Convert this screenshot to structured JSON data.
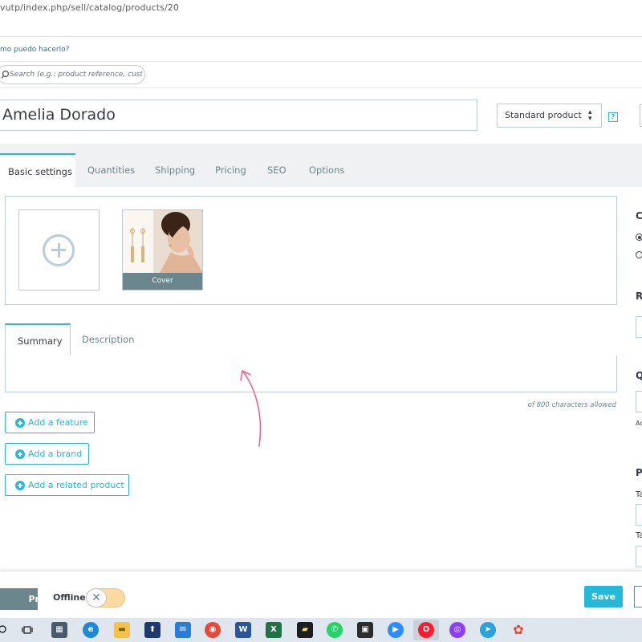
{
  "browser": {
    "url": "vutp/index.php/sell/catalog/products/20"
  },
  "header": {
    "help_link": "mo puedo hacerlo?",
    "search_placeholder": "Search (e.g.: product reference, custome"
  },
  "product": {
    "name": "Amelia Dorado",
    "type": "Standard product",
    "help_icon": "?"
  },
  "tabs": [
    {
      "label": "Basic settings",
      "active": true
    },
    {
      "label": "Quantities"
    },
    {
      "label": "Shipping"
    },
    {
      "label": "Pricing"
    },
    {
      "label": "SEO"
    },
    {
      "label": "Options"
    }
  ],
  "images": {
    "cover_label": "Cover"
  },
  "description_tabs": {
    "summary": "Summary",
    "description": "Description"
  },
  "char_counter": "of 800 characters allowed",
  "actions": {
    "add_feature": "Add a feature",
    "add_brand": "Add a brand",
    "add_related": "Add a related product"
  },
  "right_column": {
    "c": "C",
    "r": "R",
    "q": "Q",
    "p": "P",
    "ta1": "Ta",
    "ta2": "Ta",
    "ac": "Ac"
  },
  "footer": {
    "preview": "Preview",
    "offline": "Offline",
    "save": "Save"
  },
  "colors": {
    "accent": "#25b9d7",
    "muted": "#6c868e",
    "toggle_off": "#fbd9a0",
    "arrow_annotation": "#f06292"
  },
  "taskbar_icons": [
    "search-icon",
    "task-view-icon",
    "calculator-icon",
    "edge-icon",
    "file-explorer-icon",
    "upload-app-icon",
    "mail-icon",
    "chrome-icon",
    "word-icon",
    "excel-icon",
    "sticky-notes-icon",
    "whatsapp-icon",
    "store-icon",
    "zoom-icon",
    "opera-icon",
    "opera-gx-icon",
    "telegram-icon",
    "photos-icon"
  ]
}
